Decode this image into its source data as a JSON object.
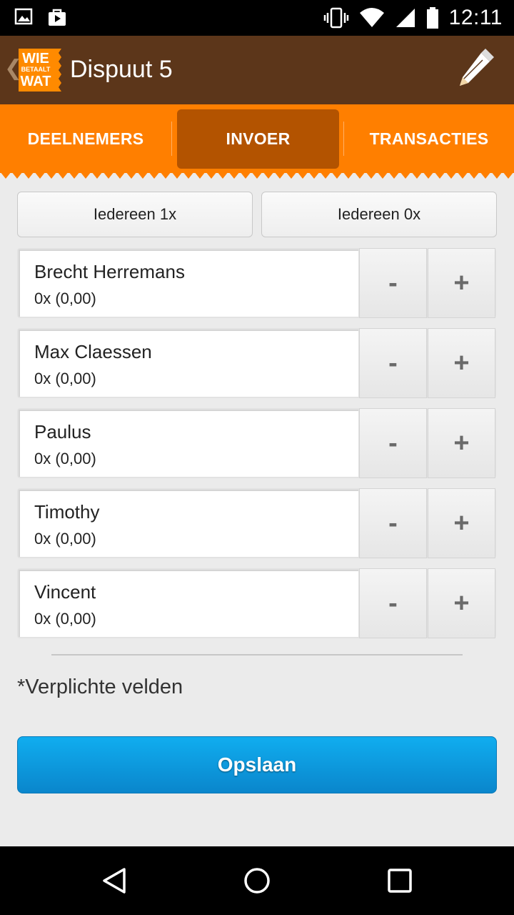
{
  "status_bar": {
    "time": "12:11",
    "icons": [
      "image-icon",
      "shopping-bag-icon",
      "vibrate-icon",
      "wifi-icon",
      "signal-icon",
      "battery-icon"
    ]
  },
  "app_bar": {
    "title": "Dispuut 5",
    "logo": {
      "line1": "WIE",
      "line2": "BETAALT",
      "line3": "WAT"
    },
    "edit_icon": "pencil-icon",
    "back_icon": "chevron-left-icon"
  },
  "tabs": [
    {
      "label": "DEELNEMERS",
      "active": false
    },
    {
      "label": "INVOER",
      "active": true
    },
    {
      "label": "TRANSACTIES",
      "active": false
    }
  ],
  "bulk_buttons": {
    "all_one": "Iedereen 1x",
    "all_zero": "Iedereen 0x"
  },
  "participants": [
    {
      "name": "Brecht Herremans",
      "count": "0x (0,00)",
      "minus": "-",
      "plus": "+"
    },
    {
      "name": "Max Claessen",
      "count": "0x (0,00)",
      "minus": "-",
      "plus": "+"
    },
    {
      "name": "Paulus",
      "count": "0x (0,00)",
      "minus": "-",
      "plus": "+"
    },
    {
      "name": "Timothy",
      "count": "0x (0,00)",
      "minus": "-",
      "plus": "+"
    },
    {
      "name": "Vincent",
      "count": "0x (0,00)",
      "minus": "-",
      "plus": "+"
    }
  ],
  "required_note": "*Verplichte velden",
  "save_label": "Opslaan",
  "colors": {
    "app_bar": "#5c361a",
    "tab_bar": "#ff7f00",
    "tab_active": "#b35300",
    "save_button": "#0a9ae0",
    "logo": "#ff8a00"
  },
  "nav": [
    "back-icon",
    "home-icon",
    "recents-icon"
  ]
}
